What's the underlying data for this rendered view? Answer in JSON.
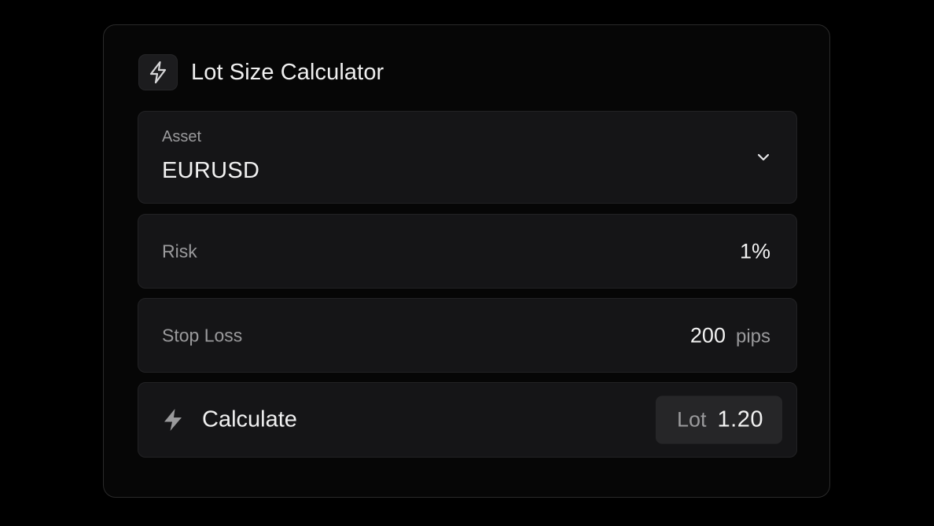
{
  "title": "Lot Size Calculator",
  "icons": {
    "header": "lightning-bolt-icon",
    "asset_dropdown": "chevron-down-icon",
    "calculate": "lightning-bolt-icon"
  },
  "colors": {
    "background": "#000000",
    "card": "#060606",
    "field": "#151517",
    "badge": "#262628",
    "text_primary": "#f2f2f2",
    "text_secondary": "#9a9a9c"
  },
  "asset": {
    "label": "Asset",
    "value": "EURUSD"
  },
  "risk": {
    "label": "Risk",
    "value": "1%"
  },
  "stop_loss": {
    "label": "Stop Loss",
    "value": "200",
    "unit": "pips"
  },
  "calculate": {
    "label": "Calculate",
    "result_label": "Lot",
    "result_value": "1.20"
  }
}
